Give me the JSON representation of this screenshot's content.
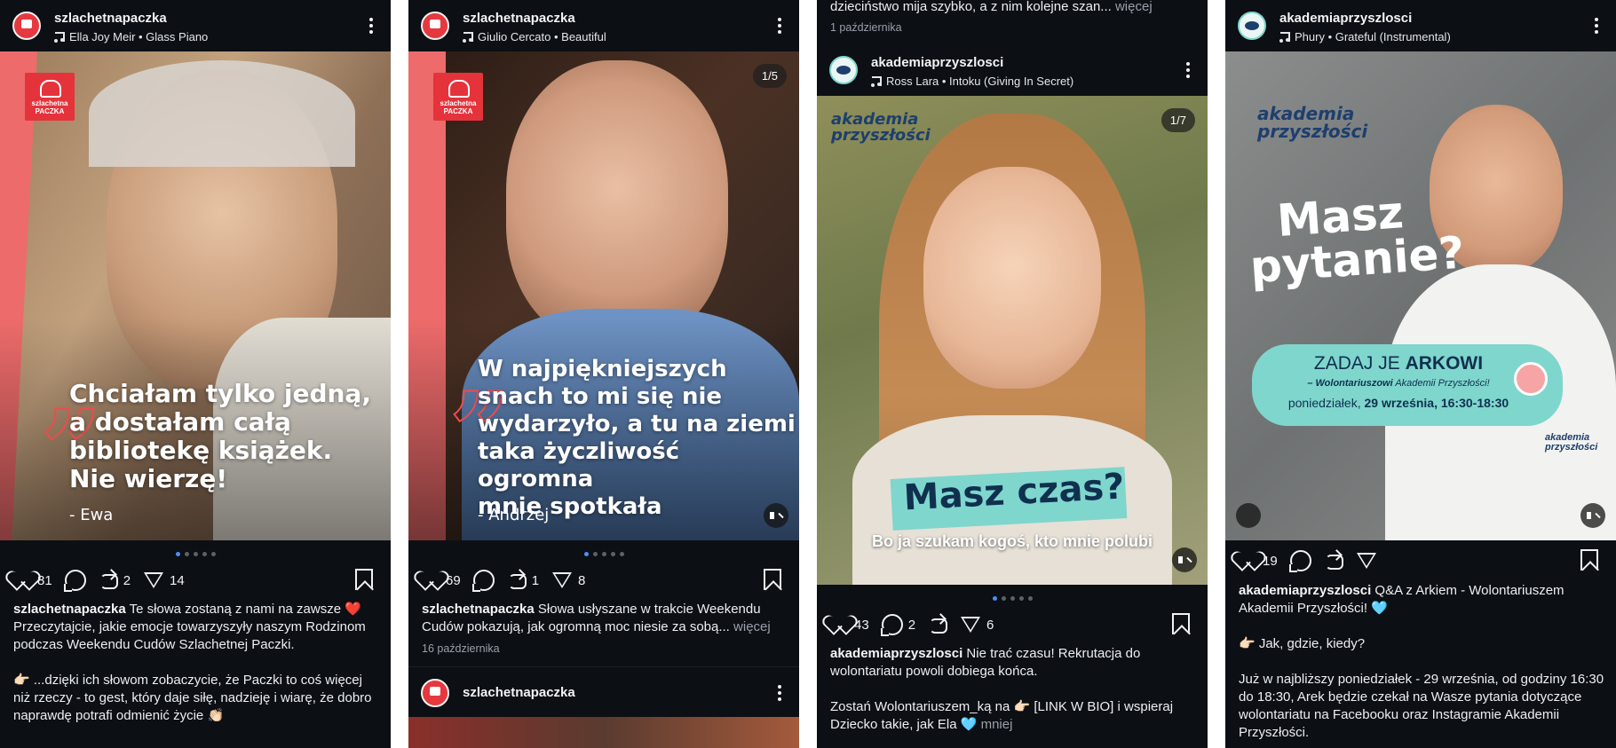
{
  "panels": [
    {
      "username": "szlachetnapaczka",
      "music": "Ella Joy Meir • Glass Piano",
      "brand_line1": "szlachetna",
      "brand_line2": "PACZKA",
      "quote": "Chciałam tylko jedną,\na dostałam całą\nbibliotekę książek.\nNie wierzę!",
      "author": "-  Ewa",
      "likes": "81",
      "reposts": "2",
      "shares": "14",
      "caption_user": "szlachetnapaczka",
      "caption": " Te słowa zostaną z nami na zawsze ❤️\nPrzeczytajcie, jakie emocje towarzyszyły naszym Rodzinom podczas Weekendu Cudów Szlachetnej Paczki.\n\n👉🏻 ...dzięki ich słowom zobaczycie, że Paczki to coś więcej niż rzeczy - to gest, który daje siłę, nadzieję i wiarę, że dobro naprawdę potrafi odmienić życie 👏🏻"
    },
    {
      "username": "szlachetnapaczka",
      "music": "Giulio Cercato • Beautiful",
      "counter": "1/5",
      "brand_line1": "szlachetna",
      "brand_line2": "PACZKA",
      "quote": "W najpiękniejszych\nsnach to mi się nie\nwydarzyło, a tu na ziemi\ntaka życzliwość ogromna\nmnie spotkała",
      "author": "- Andrzej",
      "likes": "69",
      "reposts": "1",
      "shares": "8",
      "caption_user": "szlachetnapaczka",
      "caption": " Słowa usłyszane w trakcie Weekendu Cudów pokazują, jak ogromną moc niesie za sobą...",
      "more": " więcej",
      "date": "16 października",
      "next_username": "szlachetnapaczka"
    },
    {
      "prev_caption": "dzieciństwo mija szybko, a z nim kolejne szan...",
      "prev_more": " więcej",
      "prev_date": "1 października",
      "username": "akademiaprzyszlosci",
      "music": "Ross Lara • Intoku (Giving In Secret)",
      "counter": "1/7",
      "logo_line1": "akademia",
      "logo_line2": "przyszłości",
      "headline": "Masz czas?",
      "subline": "Bo ja szukam kogoś, kto mnie polubi",
      "likes": "43",
      "comments": "2",
      "shares": "6",
      "caption_user": "akademiaprzyszlosci",
      "caption": " Nie trać czasu! Rekrutacja do wolontariatu powoli dobiega końca.\n\nZostań Wolontariuszem_ką na 👉🏻 [LINK W BIO] i wspieraj Dziecko takie, jak Ela 🩵",
      "more": " mniej"
    },
    {
      "username": "akademiaprzyszlosci",
      "music": "Phury • Grateful (Instrumental)",
      "logo_line1": "akademia",
      "logo_line2": "przyszłości",
      "headline_1": "Masz",
      "headline_2": "pytanie?",
      "banner_1": "ZADAJ JE",
      "banner_2": "ARKOWI",
      "banner_3a": "– Wolontariuszowi",
      "banner_3b": " Akademii Przyszłości!",
      "banner_4a": "poniedziałek, ",
      "banner_4b": "29 września, 16:30-18:30",
      "shirt_logo_1": "akademia",
      "shirt_logo_2": "przyszłości",
      "likes": "19",
      "caption_user": "akademiaprzyszlosci",
      "caption": " Q&A z Arkiem - Wolontariuszem Akademii Przyszłości! 🩵\n\n👉🏻 Jak, gdzie, kiedy?\n\nJuż w najbliższy poniedziałek - 29 września, od godziny 16:30 do 18:30, Arek będzie czekał na Wasze pytania dotyczące wolontariatu na Facebooku oraz Instagramie Akademii Przyszłości."
    }
  ],
  "colors": {
    "background": "#0c0f14",
    "accent_red": "#e5333c",
    "dot_active": "#4f8ef7",
    "teal_banner": "#7fd6cd"
  }
}
